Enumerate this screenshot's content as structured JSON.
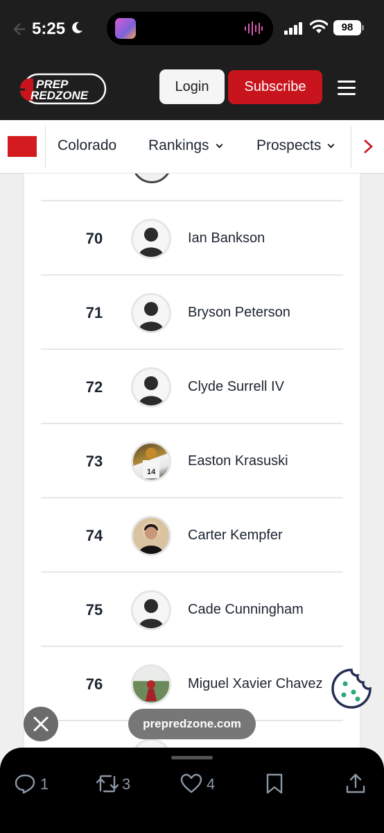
{
  "status_bar": {
    "time": "5:25",
    "battery": "98"
  },
  "header": {
    "logo_text_line1": "PREP",
    "logo_text_line2": "REDZONE",
    "login_label": "Login",
    "subscribe_label": "Subscribe"
  },
  "subnav": {
    "items": [
      "Colorado",
      "Rankings",
      "Prospects"
    ]
  },
  "rankings": [
    {
      "rank": "70",
      "name": "Ian Bankson",
      "avatar": "placeholder-silhouette"
    },
    {
      "rank": "71",
      "name": "Bryson Peterson",
      "avatar": "placeholder-silhouette"
    },
    {
      "rank": "72",
      "name": "Clyde Surrell IV",
      "avatar": "placeholder-silhouette"
    },
    {
      "rank": "73",
      "name": "Easton Krasuski",
      "avatar": "player-photo"
    },
    {
      "rank": "74",
      "name": "Carter Kempfer",
      "avatar": "player-photo"
    },
    {
      "rank": "75",
      "name": "Cade Cunningham",
      "avatar": "placeholder-silhouette"
    },
    {
      "rank": "76",
      "name": "Miguel Xavier Chavez",
      "avatar": "player-photo"
    }
  ],
  "overlay": {
    "domain": "prepredzone.com"
  },
  "tweet_actions": {
    "replies": "1",
    "retweets": "3",
    "likes": "4"
  },
  "colors": {
    "brand_red": "#c8141c",
    "header_bg": "#1e1e1e",
    "text_dark": "#1c2430"
  }
}
